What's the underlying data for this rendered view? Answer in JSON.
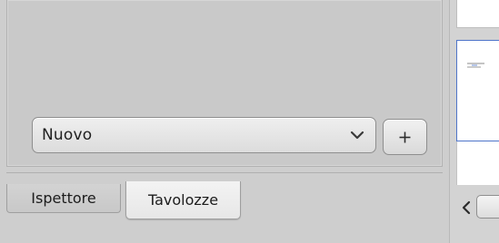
{
  "preset_selector": {
    "selected_value": "Nuovo",
    "dropdown_icon": "chevron-down-icon",
    "add_button_label": "+",
    "add_button_icon": "plus-icon"
  },
  "tabs": [
    {
      "label": "Ispettore",
      "active": false
    },
    {
      "label": "Tavolozze",
      "active": true
    }
  ],
  "preview": {
    "scroll_left_icon": "chevron-left-icon",
    "selection_color": "#4f75c9"
  }
}
